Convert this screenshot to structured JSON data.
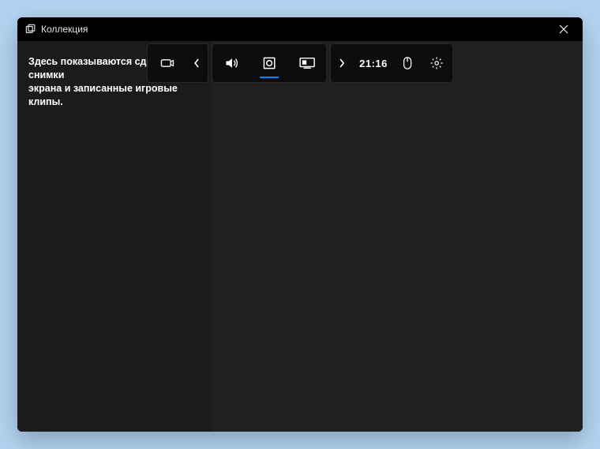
{
  "title": "Коллекция",
  "sidebar": {
    "message": "Здесь показываются сделанные снимки\nэкрана и записанные игровые клипы."
  },
  "toolbar": {
    "time": "21:16"
  }
}
